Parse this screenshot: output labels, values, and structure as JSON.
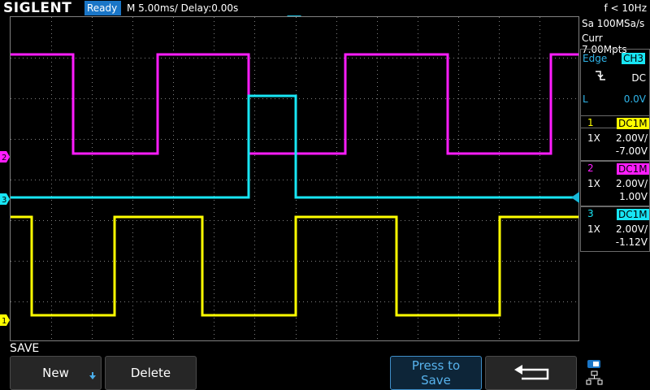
{
  "brand": "SIGLENT",
  "status": "Ready",
  "timebase": "M 5.00ms/ Delay:0.00s",
  "frequency": "f < 10Hz",
  "acquisition": {
    "sample_rate": "Sa 100MSa/s",
    "memory": "Curr 7.00Mpts"
  },
  "trigger": {
    "type": "Edge",
    "source": "CH3",
    "coupling": "DC",
    "mode_label": "L",
    "level": "0.0V"
  },
  "channels": [
    {
      "number": "1",
      "coupling": "DC1M",
      "probe": "1X",
      "scale": "2.00V/",
      "offset": "-7.00V",
      "color": "#ffff00"
    },
    {
      "number": "2",
      "coupling": "DC1M",
      "probe": "1X",
      "scale": "2.00V/",
      "offset": "1.00V",
      "color": "#ff1dff"
    },
    {
      "number": "3",
      "coupling": "DC1M",
      "probe": "1X",
      "scale": "2.00V/",
      "offset": "-1.12V",
      "color": "#18e6f5"
    }
  ],
  "bottom": {
    "menu_title": "SAVE",
    "buttons": {
      "new": "New",
      "delete": "Delete",
      "press_line1": "Press to",
      "press_line2": "Save"
    }
  },
  "colors": {
    "accent": "#1a76c7",
    "grid": "#808080"
  }
}
